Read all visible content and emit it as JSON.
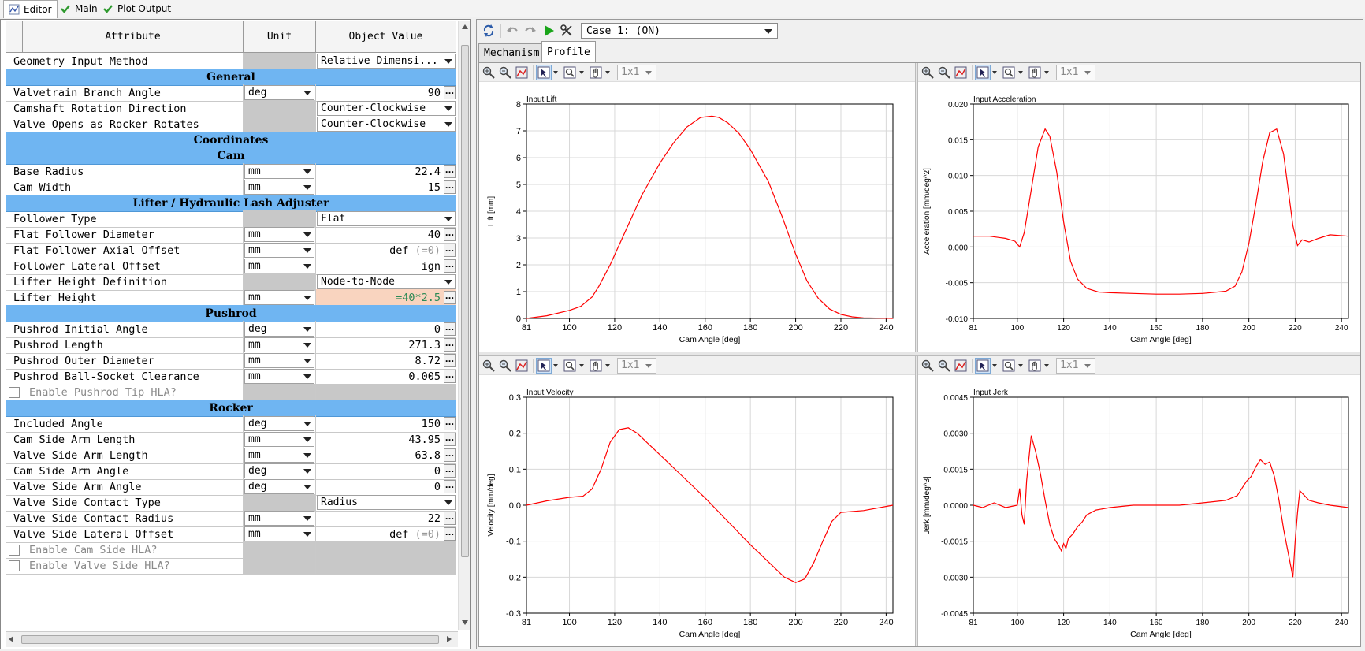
{
  "top_tabs": [
    {
      "label": "Editor",
      "icon": "chart-icon",
      "active": true
    },
    {
      "label": "Main",
      "icon": "check-icon",
      "active": false
    },
    {
      "label": "Plot Output",
      "icon": "check-icon",
      "active": false
    }
  ],
  "grid": {
    "headers": {
      "attribute": "Attribute",
      "unit": "Unit",
      "value": "Object Value"
    },
    "rows": [
      {
        "kind": "row",
        "attr": "Geometry Input Method",
        "unit": null,
        "value": "Relative Dimensi...",
        "vtype": "select"
      },
      {
        "kind": "section",
        "label": "General"
      },
      {
        "kind": "row",
        "attr": "Valvetrain Branch Angle",
        "unit": "deg",
        "value": "90",
        "vtype": "num"
      },
      {
        "kind": "row",
        "attr": "Camshaft Rotation Direction",
        "unit": null,
        "value": "Counter-Clockwise",
        "vtype": "select"
      },
      {
        "kind": "row",
        "attr": "Valve Opens as Rocker Rotates",
        "unit": null,
        "value": "Counter-Clockwise",
        "vtype": "select"
      },
      {
        "kind": "section",
        "label": "Coordinates"
      },
      {
        "kind": "section",
        "label": "Cam"
      },
      {
        "kind": "row",
        "attr": "Base Radius",
        "unit": "mm",
        "value": "22.4",
        "vtype": "num"
      },
      {
        "kind": "row",
        "attr": "Cam Width",
        "unit": "mm",
        "value": "15",
        "vtype": "num"
      },
      {
        "kind": "section",
        "label": "Lifter / Hydraulic Lash Adjuster"
      },
      {
        "kind": "row",
        "attr": "Follower Type",
        "unit": null,
        "value": "Flat",
        "vtype": "select"
      },
      {
        "kind": "row",
        "attr": "Flat Follower Diameter",
        "unit": "mm",
        "value": "40",
        "vtype": "num"
      },
      {
        "kind": "row",
        "attr": "Flat Follower Axial Offset",
        "unit": "mm",
        "value": "def",
        "value_hint": "(=0)",
        "vtype": "num"
      },
      {
        "kind": "row",
        "attr": "Follower Lateral Offset",
        "unit": "mm",
        "value": "ign",
        "vtype": "num"
      },
      {
        "kind": "row",
        "attr": "Lifter Height Definition",
        "unit": null,
        "value": "Node-to-Node",
        "vtype": "select"
      },
      {
        "kind": "row",
        "attr": "Lifter Height",
        "unit": "mm",
        "value": "=40*2.5",
        "vtype": "num",
        "highlight": "#f9d4bf",
        "color": "#2e8b57"
      },
      {
        "kind": "section",
        "label": "Pushrod"
      },
      {
        "kind": "row",
        "attr": "Pushrod Initial Angle",
        "unit": "deg",
        "value": "0",
        "vtype": "num"
      },
      {
        "kind": "row",
        "attr": "Pushrod Length",
        "unit": "mm",
        "value": "271.3",
        "vtype": "num"
      },
      {
        "kind": "row",
        "attr": "Pushrod Outer Diameter",
        "unit": "mm",
        "value": "8.72",
        "vtype": "num"
      },
      {
        "kind": "row",
        "attr": "Pushrod Ball-Socket Clearance",
        "unit": "mm",
        "value": "0.005",
        "vtype": "num"
      },
      {
        "kind": "check",
        "attr": "Enable Pushrod Tip HLA?"
      },
      {
        "kind": "section",
        "label": "Rocker"
      },
      {
        "kind": "row",
        "attr": "Included Angle",
        "unit": "deg",
        "value": "150",
        "vtype": "num"
      },
      {
        "kind": "row",
        "attr": "Cam Side Arm Length",
        "unit": "mm",
        "value": "43.95",
        "vtype": "num"
      },
      {
        "kind": "row",
        "attr": "Valve Side Arm Length",
        "unit": "mm",
        "value": "63.8",
        "vtype": "num"
      },
      {
        "kind": "row",
        "attr": "Cam Side Arm Angle",
        "unit": "deg",
        "value": "0",
        "vtype": "num"
      },
      {
        "kind": "row",
        "attr": "Valve Side Arm Angle",
        "unit": "deg",
        "value": "0",
        "vtype": "num"
      },
      {
        "kind": "row",
        "attr": "Valve Side Contact Type",
        "unit": null,
        "value": "Radius",
        "vtype": "select"
      },
      {
        "kind": "row",
        "attr": "Valve Side Contact Radius",
        "unit": "mm",
        "value": "22",
        "vtype": "num"
      },
      {
        "kind": "row",
        "attr": "Valve Side Lateral Offset",
        "unit": "mm",
        "value": "def",
        "value_hint": "(=0)",
        "vtype": "num"
      },
      {
        "kind": "check",
        "attr": "Enable Cam Side HLA?"
      },
      {
        "kind": "check",
        "attr": "Enable Valve Side HLA?"
      }
    ]
  },
  "right": {
    "case_select": "Case 1:  (ON)",
    "subtabs": [
      {
        "label": "Mechanism",
        "active": false
      },
      {
        "label": "Profile",
        "active": true
      }
    ],
    "layout_value": "1x1"
  },
  "colors": {
    "section": "#6fb5f2",
    "trace": "#ff0000",
    "highlight": "#f9d4bf"
  },
  "chart_data": [
    {
      "type": "line",
      "title": "Input Lift",
      "xlabel": "Cam Angle [deg]",
      "ylabel": "Lift [mm]",
      "xlim": [
        81,
        243
      ],
      "ylim": [
        0,
        8
      ],
      "xticks": [
        81,
        100,
        120,
        140,
        160,
        180,
        200,
        220,
        240
      ],
      "yticks": [
        0,
        1,
        2,
        3,
        4,
        5,
        6,
        7,
        8
      ],
      "ytick_labels": [
        "0",
        "1",
        "2",
        "3",
        "4",
        "5",
        "6",
        "7",
        "8"
      ],
      "series": [
        {
          "x": [
            81,
            90,
            100,
            105,
            110,
            113,
            118,
            125,
            132,
            140,
            146,
            152,
            158,
            163,
            166,
            170,
            175,
            180,
            188,
            194,
            200,
            205,
            210,
            215,
            220,
            225,
            230,
            243
          ],
          "y": [
            0,
            0.1,
            0.3,
            0.45,
            0.8,
            1.2,
            2.0,
            3.3,
            4.6,
            5.8,
            6.55,
            7.15,
            7.5,
            7.55,
            7.5,
            7.3,
            6.9,
            6.3,
            5.1,
            3.8,
            2.4,
            1.4,
            0.75,
            0.35,
            0.15,
            0.06,
            0.02,
            0
          ]
        }
      ]
    },
    {
      "type": "line",
      "title": "Input Acceleration",
      "xlabel": "Cam Angle [deg]",
      "ylabel": "Acceleration [mm/deg^2]",
      "xlim": [
        81,
        243
      ],
      "ylim": [
        -0.01,
        0.02
      ],
      "xticks": [
        81,
        100,
        120,
        140,
        160,
        180,
        200,
        220,
        240
      ],
      "yticks": [
        -0.01,
        -0.005,
        0,
        0.005,
        0.01,
        0.015,
        0.02
      ],
      "ytick_labels": [
        "-0.010",
        "-0.005",
        "0.000",
        "0.005",
        "0.010",
        "0.015",
        "0.020"
      ],
      "series": [
        {
          "x": [
            81,
            88,
            95,
            99,
            101,
            103,
            106,
            109,
            112,
            114,
            117,
            120,
            123,
            126,
            130,
            135,
            140,
            150,
            160,
            170,
            180,
            190,
            194,
            197,
            200,
            203,
            206,
            209,
            212,
            215,
            217,
            219,
            221,
            223,
            226,
            230,
            235,
            243
          ],
          "y": [
            0.0015,
            0.0015,
            0.0012,
            0.0008,
            0.0,
            0.002,
            0.008,
            0.014,
            0.0165,
            0.0155,
            0.0105,
            0.0035,
            -0.002,
            -0.0045,
            -0.0058,
            -0.0063,
            -0.0064,
            -0.0065,
            -0.0066,
            -0.0066,
            -0.0065,
            -0.0062,
            -0.0055,
            -0.0035,
            0.0005,
            0.006,
            0.012,
            0.016,
            0.0165,
            0.013,
            0.008,
            0.003,
            0.0002,
            0.001,
            0.0007,
            0.0012,
            0.0017,
            0.0015
          ]
        }
      ]
    },
    {
      "type": "line",
      "title": "Input Velocity",
      "xlabel": "Cam Angle [deg]",
      "ylabel": "Velocity [mm/deg]",
      "xlim": [
        81,
        243
      ],
      "ylim": [
        -0.3,
        0.3
      ],
      "xticks": [
        81,
        100,
        120,
        140,
        160,
        180,
        200,
        220,
        240
      ],
      "yticks": [
        -0.3,
        -0.2,
        -0.1,
        0,
        0.1,
        0.2,
        0.3
      ],
      "ytick_labels": [
        "-0.3",
        "-0.2",
        "-0.1",
        "0.0",
        "0.1",
        "0.2",
        "0.3"
      ],
      "series": [
        {
          "x": [
            81,
            90,
            100,
            106,
            110,
            114,
            118,
            122,
            126,
            130,
            135,
            140,
            150,
            160,
            170,
            180,
            190,
            195,
            200,
            204,
            208,
            212,
            216,
            220,
            230,
            243
          ],
          "y": [
            0.0,
            0.012,
            0.022,
            0.025,
            0.045,
            0.1,
            0.175,
            0.21,
            0.215,
            0.2,
            0.17,
            0.14,
            0.08,
            0.02,
            -0.045,
            -0.11,
            -0.17,
            -0.2,
            -0.215,
            -0.205,
            -0.16,
            -0.1,
            -0.045,
            -0.02,
            -0.015,
            0.0
          ]
        }
      ]
    },
    {
      "type": "line",
      "title": "Input Jerk",
      "xlabel": "Cam Angle [deg]",
      "ylabel": "Jerk [mm/deg^3]",
      "xlim": [
        81,
        243
      ],
      "ylim": [
        -0.0045,
        0.0045
      ],
      "xticks": [
        81,
        100,
        120,
        140,
        160,
        180,
        200,
        220,
        240
      ],
      "yticks": [
        -0.0045,
        -0.003,
        -0.0015,
        0,
        0.0015,
        0.003,
        0.0045
      ],
      "ytick_labels": [
        "-0.0045",
        "-0.0030",
        "-0.0015",
        "0.0000",
        "0.0015",
        "0.0030",
        "0.0045"
      ],
      "series": [
        {
          "x": [
            81,
            85,
            90,
            95,
            100,
            101,
            102,
            103,
            104,
            106,
            108,
            110,
            112,
            114,
            116,
            118,
            119,
            120,
            121,
            122,
            124,
            126,
            128,
            130,
            134,
            140,
            150,
            160,
            170,
            180,
            190,
            195,
            197,
            199,
            201,
            203,
            205,
            207,
            209,
            211,
            213,
            215,
            217,
            219,
            220,
            221,
            222,
            224,
            226,
            230,
            235,
            243
          ],
          "y": [
            0.0,
            -0.0001,
            0.0001,
            -0.0001,
            0.0,
            0.0007,
            -0.0004,
            -0.0008,
            0.001,
            0.0029,
            0.0022,
            0.0013,
            0.0002,
            -0.0008,
            -0.0014,
            -0.0017,
            -0.0019,
            -0.0016,
            -0.0018,
            -0.0014,
            -0.0012,
            -0.0009,
            -0.0007,
            -0.0004,
            -0.0002,
            -0.0001,
            0.0,
            0.0,
            0.0,
            0.0001,
            0.0002,
            0.0004,
            0.0007,
            0.001,
            0.0012,
            0.0016,
            0.0019,
            0.0017,
            0.0018,
            0.0012,
            0.0002,
            -0.001,
            -0.002,
            -0.003,
            -0.0015,
            -0.0003,
            0.0006,
            0.0004,
            0.0002,
            0.0001,
            0.0,
            -0.0001
          ]
        }
      ]
    }
  ]
}
